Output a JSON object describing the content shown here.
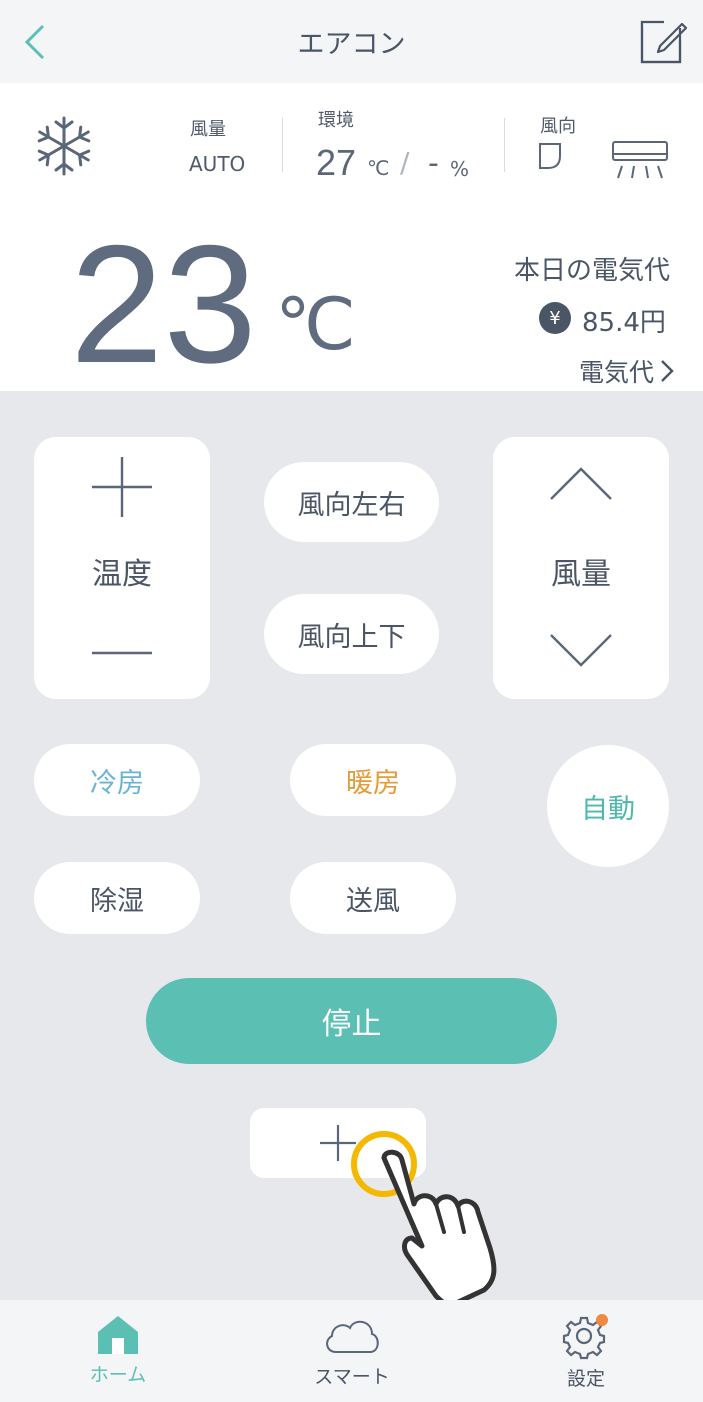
{
  "header": {
    "title": "エアコン"
  },
  "status": {
    "fan_label": "風量",
    "fan_value": "AUTO",
    "env_label": "環境",
    "env_temp": "27",
    "env_temp_unit": "℃",
    "env_separator": "/",
    "env_humidity": "-",
    "env_humidity_unit": "%",
    "direction_label": "風向",
    "set_temp": "23",
    "set_temp_unit": "℃",
    "cost_title": "本日の電気代",
    "cost_currency_symbol": "¥",
    "cost_value": "85.4円",
    "cost_link": "電気代"
  },
  "controls": {
    "temp_label": "温度",
    "fan_label": "風量",
    "swing_lr": "風向左右",
    "swing_ud": "風向上下",
    "mode_cool": "冷房",
    "mode_heat": "暖房",
    "mode_auto": "自動",
    "mode_dry": "除湿",
    "mode_fan": "送風",
    "stop": "停止"
  },
  "colors": {
    "accent": "#5bbfb4",
    "cool": "#6ab3d3",
    "heat": "#e29c3a",
    "badge": "#f08a3e",
    "highlight": "#f5b800"
  },
  "icons": {
    "mode": "snowflake-icon",
    "louver": "louver-icon",
    "ac_unit": "ac-unit-icon",
    "yen": "yen-icon",
    "gesture": "tap-hand-icon"
  },
  "nav": {
    "home": "ホーム",
    "smart": "スマート",
    "settings": "設定",
    "active": "home"
  }
}
